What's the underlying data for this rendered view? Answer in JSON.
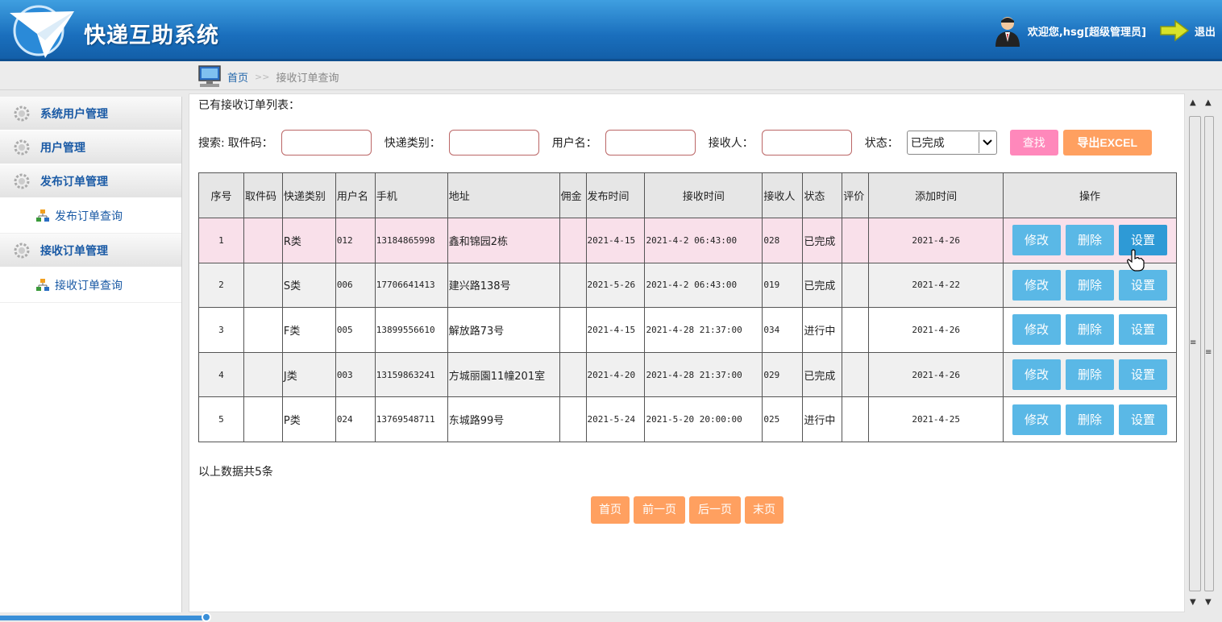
{
  "header": {
    "title": "快递互助系统",
    "welcome": "欢迎您,hsg[超级管理员]",
    "logout": "退出"
  },
  "breadcrumb": {
    "home": "首页",
    "sep": ">>",
    "current": "接收订单查询"
  },
  "sidebar": {
    "items": [
      {
        "label": "系统用户管理",
        "type": "group"
      },
      {
        "label": "用户管理",
        "type": "group"
      },
      {
        "label": "发布订单管理",
        "type": "group"
      },
      {
        "label": "发布订单查询",
        "type": "sub"
      },
      {
        "label": "接收订单管理",
        "type": "group"
      },
      {
        "label": "接收订单查询",
        "type": "sub"
      }
    ]
  },
  "main": {
    "list_title": "已有接收订单列表：",
    "search": {
      "prefix": "搜索:",
      "pickup_label": "取件码：",
      "type_label": "快递类别：",
      "username_label": "用户名：",
      "receiver_label": "接收人：",
      "status_label": "状态：",
      "status_value": "已完成",
      "find_button": "查找",
      "export_button": "导出EXCEL"
    },
    "table": {
      "headers": [
        "序号",
        "取件码",
        "快递类别",
        "用户名",
        "手机",
        "地址",
        "佣金",
        "发布时间",
        "接收时间",
        "接收人",
        "状态",
        "评价",
        "添加时间",
        "操作"
      ],
      "rows": [
        [
          "1",
          "",
          "R类",
          "012",
          "13184865998",
          "鑫和锦园2栋",
          "",
          "2021-4-15",
          "2021-4-2 06:43:00",
          "028",
          "已完成",
          "",
          "2021-4-26"
        ],
        [
          "2",
          "",
          "S类",
          "006",
          "17706641413",
          "建兴路138号",
          "",
          "2021-5-26",
          "2021-4-2 06:43:00",
          "019",
          "已完成",
          "",
          "2021-4-22"
        ],
        [
          "3",
          "",
          "F类",
          "005",
          "13899556610",
          "解放路73号",
          "",
          "2021-4-15",
          "2021-4-28 21:37:00",
          "034",
          "进行中",
          "",
          "2021-4-26"
        ],
        [
          "4",
          "",
          "J类",
          "003",
          "13159863241",
          "方城丽園11幢201室",
          "",
          "2021-4-20",
          "2021-4-28 21:37:00",
          "029",
          "已完成",
          "",
          "2021-4-26"
        ],
        [
          "5",
          "",
          "P类",
          "024",
          "13769548711",
          "东城路99号",
          "",
          "2021-5-24",
          "2021-5-20 20:00:00",
          "025",
          "进行中",
          "",
          "2021-4-25"
        ]
      ],
      "actions": {
        "edit": "修改",
        "delete": "删除",
        "set": "设置"
      }
    },
    "count_text": "以上数据共5条",
    "pager": {
      "first": "首页",
      "prev": "前一页",
      "next": "后一页",
      "last": "末页"
    }
  },
  "colors": {
    "header": "#1a6fbd",
    "find": "#ff88bb",
    "export": "#ffa060",
    "action": "#5ab8e6"
  }
}
